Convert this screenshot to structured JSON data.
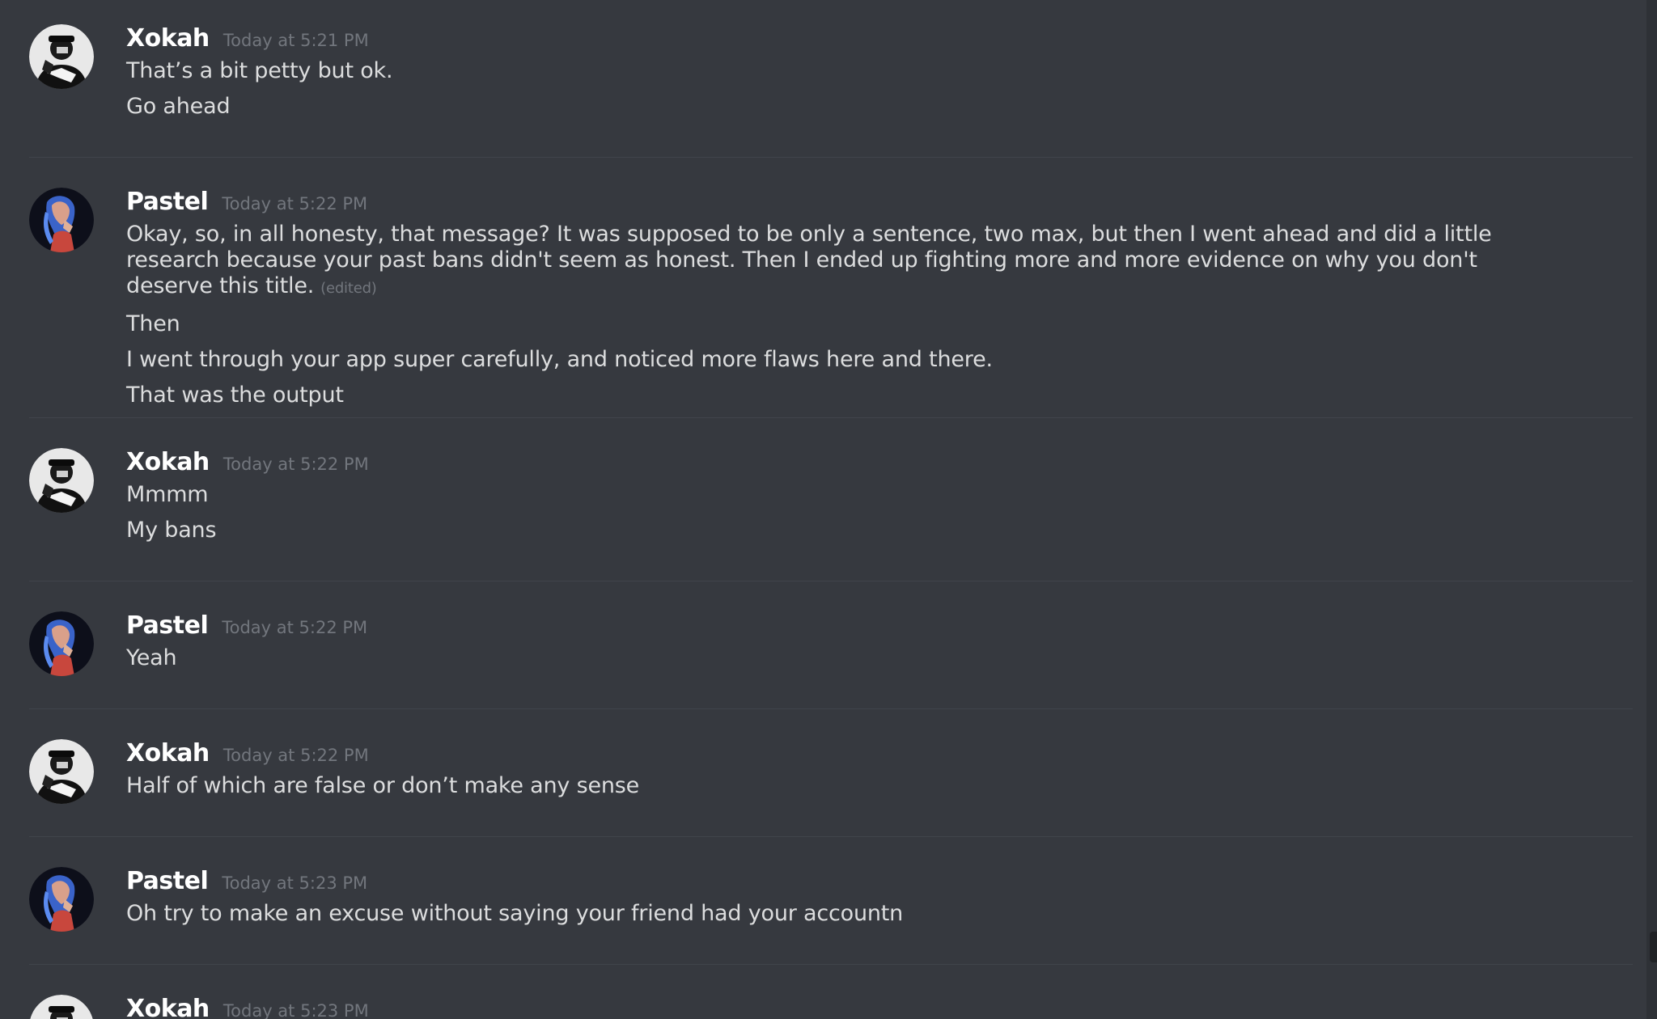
{
  "messages": [
    {
      "author": "Xokah",
      "timestamp": "Today at 5:21 PM",
      "lines": [
        "That’s a bit petty but ok.",
        "Go ahead"
      ]
    },
    {
      "author": "Pastel",
      "timestamp": "Today at 5:22 PM",
      "lines": [
        "Okay, so, in all honesty, that message? It was supposed to be only a sentence, two max, but then I went ahead and did a little research because your past bans didn't seem as honest. Then I ended up fighting more and more evidence on why you don't deserve this title.",
        "Then",
        "I went through your app super carefully, and noticed more flaws here and there.",
        "That was the output"
      ],
      "edited_label": "(edited)"
    },
    {
      "author": "Xokah",
      "timestamp": "Today at 5:22 PM",
      "lines": [
        "Mmmm",
        "My bans"
      ]
    },
    {
      "author": "Pastel",
      "timestamp": "Today at 5:22 PM",
      "lines": [
        "Yeah"
      ]
    },
    {
      "author": "Xokah",
      "timestamp": "Today at 5:22 PM",
      "lines": [
        "Half of which are false or don’t make any sense"
      ]
    },
    {
      "author": "Pastel",
      "timestamp": "Today at 5:23 PM",
      "lines": [
        "Oh try to make an excuse without saying your friend had your accountn"
      ]
    },
    {
      "author": "Xokah",
      "timestamp": "Today at 5:23 PM",
      "lines": []
    }
  ],
  "avatars": {
    "xokah_icon": "masked-person-avatar-icon",
    "pastel_icon": "blue-haired-person-avatar-icon"
  },
  "colors": {
    "background": "#36393f",
    "username": "#ffffff",
    "message_text": "#dcddde",
    "timestamp": "#72767d",
    "divider": "#40444b"
  }
}
